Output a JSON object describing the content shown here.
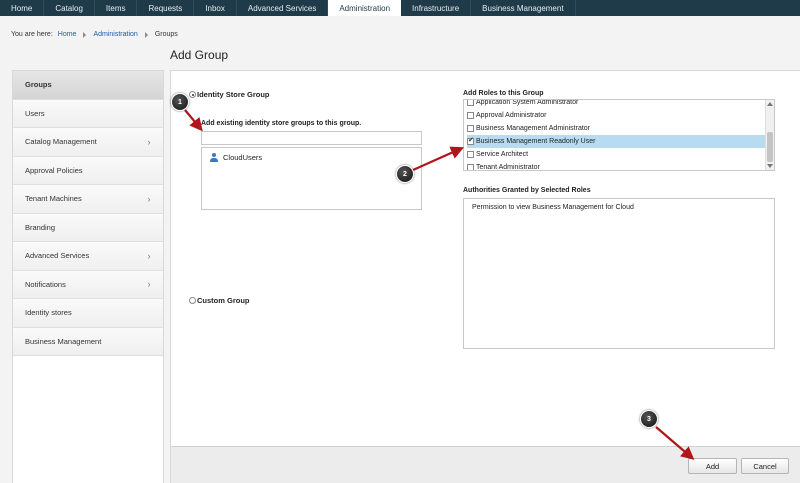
{
  "topnav": {
    "tabs": [
      {
        "label": "Home"
      },
      {
        "label": "Catalog"
      },
      {
        "label": "Items"
      },
      {
        "label": "Requests"
      },
      {
        "label": "Inbox"
      },
      {
        "label": "Advanced Services"
      },
      {
        "label": "Administration",
        "active": true
      },
      {
        "label": "Infrastructure"
      },
      {
        "label": "Business Management"
      }
    ]
  },
  "breadcrumb": {
    "prefix": "You are here:",
    "items": [
      "Home",
      "Administration",
      "Groups"
    ]
  },
  "page_title": "Add Group",
  "sidebar": {
    "items": [
      {
        "label": "Groups",
        "active": true,
        "chevron": false
      },
      {
        "label": "Users",
        "chevron": false
      },
      {
        "label": "Catalog Management",
        "chevron": true
      },
      {
        "label": "Approval Policies",
        "chevron": false
      },
      {
        "label": "Tenant Machines",
        "chevron": true
      },
      {
        "label": "Branding",
        "chevron": false
      },
      {
        "label": "Advanced Services",
        "chevron": true
      },
      {
        "label": "Notifications",
        "chevron": true
      },
      {
        "label": "Identity stores",
        "chevron": false
      },
      {
        "label": "Business Management",
        "chevron": false
      }
    ]
  },
  "form": {
    "identity_store_radio_label": "Identity Store Group",
    "add_existing_label": "Add existing identity store groups to this group.",
    "search_value": "",
    "groups": [
      {
        "name": "CloudUsers",
        "icon": "user-group-icon"
      }
    ],
    "custom_group_radio_label": "Custom Group",
    "roles_label": "Add Roles to this Group",
    "roles": [
      {
        "label": "Application System Administrator",
        "checked": false
      },
      {
        "label": "Approval Administrator",
        "checked": false
      },
      {
        "label": "Business Management Administrator",
        "checked": false
      },
      {
        "label": "Business Management Readonly User",
        "checked": true
      },
      {
        "label": "Service Architect",
        "checked": false
      },
      {
        "label": "Tenant Administrator",
        "checked": false
      }
    ],
    "authorities_label": "Authorities Granted by Selected Roles",
    "authorities_text": "Permission to view Business Management for Cloud",
    "add_button": "Add",
    "cancel_button": "Cancel"
  },
  "annotations": [
    "1",
    "2",
    "3"
  ],
  "colors": {
    "topnav_bg": "#1f3a48",
    "selected_row": "#b7dcf2",
    "link": "#1d5fa0",
    "arrow": "#b0151c"
  }
}
